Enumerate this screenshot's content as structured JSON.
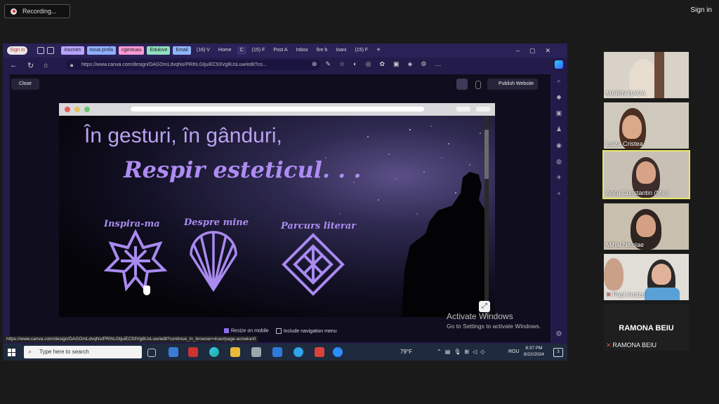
{
  "zoom": {
    "recording_label": "Recording...",
    "sign_in": "Sign in"
  },
  "browser": {
    "profile_label": "Sign in",
    "tabs": [
      {
        "label": "inscrien",
        "color": "#b8a4ff"
      },
      {
        "label": "noua profa",
        "color": "#8fb0ff"
      },
      {
        "label": "cgestuau",
        "color": "#ff9ad6"
      },
      {
        "label": "Edukive",
        "color": "#8fe0c0"
      },
      {
        "label": "Email",
        "color": "#8fb4ff"
      },
      {
        "label": "(16) V",
        "color": ""
      },
      {
        "label": "Home",
        "color": ""
      },
      {
        "label": "C",
        "color": ""
      },
      {
        "label": "(15) F",
        "color": ""
      },
      {
        "label": "Post A",
        "color": ""
      },
      {
        "label": "Inbox",
        "color": ""
      },
      {
        "label": "fire b",
        "color": ""
      },
      {
        "label": "Ioani",
        "color": ""
      },
      {
        "label": "(15) F",
        "color": ""
      }
    ],
    "url": "https://www.canva.com/design/DAGOmLdvqNs/PRIhLGtjuiEC93Vg8UsLuw/edit?co...",
    "status_url": "https://www.canva.com/design/DAGOmLdvqNs/PRIhLGtjuiEC93Vg8UsLuw/edit?continue_in_browser=true#page-acnwiun0"
  },
  "canva": {
    "close_label": "Close",
    "publish_label": "Publish Website",
    "resize_on_mobile": "Resize on mobile",
    "include_navigation": "Include navigation menu"
  },
  "site": {
    "heading_line1": "În gesturi, în gânduri,",
    "heading_line2": "Respir esteticul. . .",
    "nav": [
      {
        "label": "Inspira-ma",
        "icon": "star-icon"
      },
      {
        "label": "Despre mine",
        "icon": "shell-icon"
      },
      {
        "label": "Parcurs literar",
        "icon": "diamond-icon"
      }
    ]
  },
  "windows": {
    "activate_title": "Activate Windows",
    "activate_sub": "Go to Settings to activate Windows.",
    "search_placeholder": "Type here to search",
    "temperature": "79°F",
    "language": "ROU",
    "time": "8:37 PM",
    "date": "8/22/2024"
  },
  "participants": [
    {
      "name": "MARIN RADA",
      "muted": false
    },
    {
      "name": "Luiza Cristea",
      "muted": false
    },
    {
      "name": "Anca Constantin (Ms.)",
      "muted": false
    },
    {
      "name": "Mihai Nicolae",
      "muted": false
    },
    {
      "name": "Paul Aretzu",
      "muted": true
    },
    {
      "name": "RAMONA BEIU",
      "muted": true
    }
  ],
  "colors": {
    "accent_purple": "#ae8cf2",
    "browser_frame": "#2a2156",
    "active_speaker": "#e8e66a"
  }
}
